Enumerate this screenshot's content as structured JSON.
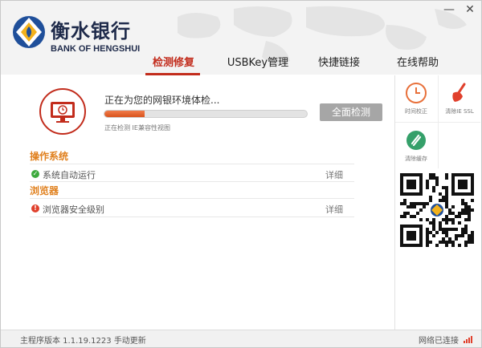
{
  "app": {
    "bank_name_cn": "衡水银行",
    "bank_name_en": "BANK OF HENGSHUI"
  },
  "window_controls": {
    "minimize": "—",
    "close": "✕"
  },
  "tabs": [
    {
      "label": "检测修复",
      "active": true
    },
    {
      "label": "USBKey管理",
      "active": false
    },
    {
      "label": "快捷链接",
      "active": false
    },
    {
      "label": "在线帮助",
      "active": false
    }
  ],
  "scan": {
    "status_text": "正在为您的网银环境体检...",
    "progress_fraction": 0.2,
    "sub_text": "正在检测 IE兼容性视图",
    "full_scan_button": "全面检测",
    "icon": "monitor-shield-icon"
  },
  "sections": [
    {
      "title": "操作系统",
      "items": [
        {
          "status": "ok",
          "label": "系统自动运行",
          "detail": "详细"
        }
      ]
    },
    {
      "title": "浏览器",
      "items": [
        {
          "status": "warn",
          "label": "浏览器安全级别",
          "detail": "详细"
        }
      ]
    }
  ],
  "tools": [
    {
      "label": "时间校正",
      "icon": "clock-icon",
      "color": "#e8703a"
    },
    {
      "label": "清除IE SSL",
      "icon": "broom-icon",
      "color": "#e0402c"
    },
    {
      "label": "清除缓存",
      "icon": "cleanup-icon",
      "color": "#35a06a"
    }
  ],
  "footer": {
    "version_text": "主程序版本 1.1.19.1223",
    "update_link": "手动更新",
    "network_status": "网络已连接"
  },
  "colors": {
    "accent": "#c22c1c",
    "section_title": "#e0801e",
    "progress": "#e0602a",
    "button_gray": "#a6a6a6"
  }
}
